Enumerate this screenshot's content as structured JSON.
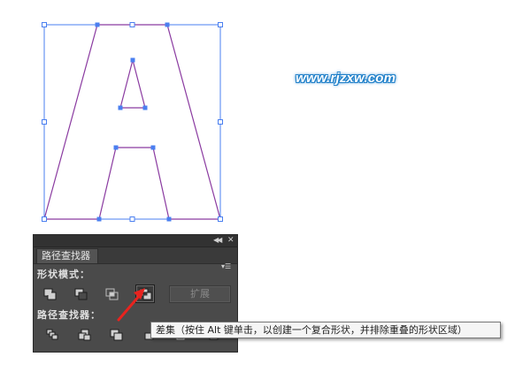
{
  "watermark": {
    "text": "www.rjzxw.com"
  },
  "panel": {
    "tab_title": "路径查找器",
    "shape_modes_label": "形状模式：",
    "pathfinders_label": "路径查找器：",
    "expand_label": "扩展",
    "shape_mode_buttons": [
      {
        "name": "unite-icon"
      },
      {
        "name": "minus-front-icon"
      },
      {
        "name": "intersect-icon"
      },
      {
        "name": "exclude-icon",
        "active": true
      }
    ],
    "pathfinder_buttons": [
      {
        "name": "divide-icon"
      },
      {
        "name": "trim-icon"
      },
      {
        "name": "merge-icon"
      },
      {
        "name": "crop-icon"
      },
      {
        "name": "outline-icon"
      },
      {
        "name": "minus-back-icon"
      }
    ]
  },
  "tooltip": {
    "text": "差集（按住 Alt 键单击，以创建一个复合形状，并排除重叠的形状区域）"
  },
  "colors": {
    "selection": "#4a7ff0",
    "path": "#8a3aa0",
    "panel_bg": "#4a4a4a",
    "arrow": "#e8231e"
  }
}
